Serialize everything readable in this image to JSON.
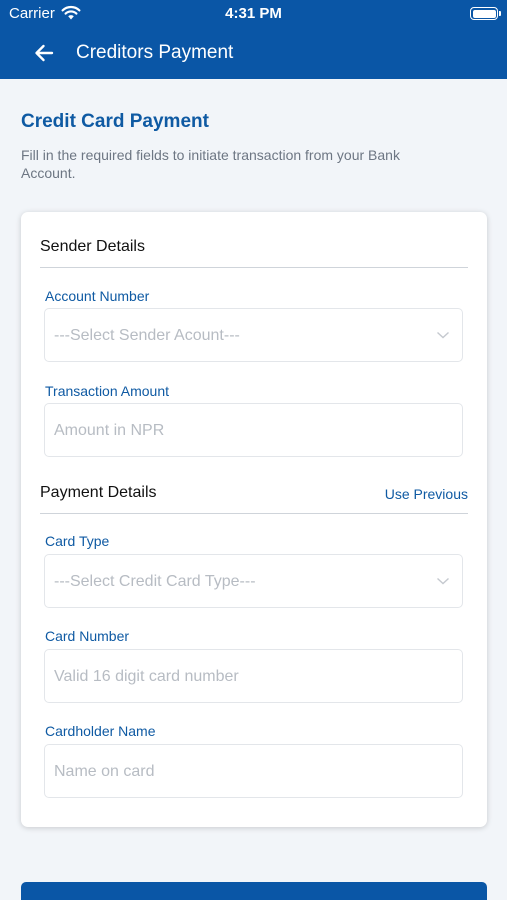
{
  "status_bar": {
    "carrier": "Carrier",
    "time": "4:31 PM"
  },
  "nav": {
    "title": "Creditors Payment"
  },
  "page": {
    "title": "Credit Card Payment",
    "description": "Fill in the required fields to initiate transaction from your Bank Account."
  },
  "sender": {
    "title": "Sender Details",
    "account_label": "Account Number",
    "account_placeholder": "---Select Sender Acount---",
    "amount_label": "Transaction Amount",
    "amount_placeholder": "Amount in NPR"
  },
  "payment": {
    "title": "Payment Details",
    "use_previous": "Use Previous",
    "card_type_label": "Card Type",
    "card_type_placeholder": "---Select Credit Card Type---",
    "card_number_label": "Card Number",
    "card_number_placeholder": "Valid 16 digit card number",
    "holder_label": "Cardholder Name",
    "holder_placeholder": "Name on card"
  },
  "colors": {
    "primary": "#0a56a6",
    "label": "#0f5aa3",
    "background": "#f2f5f9"
  }
}
